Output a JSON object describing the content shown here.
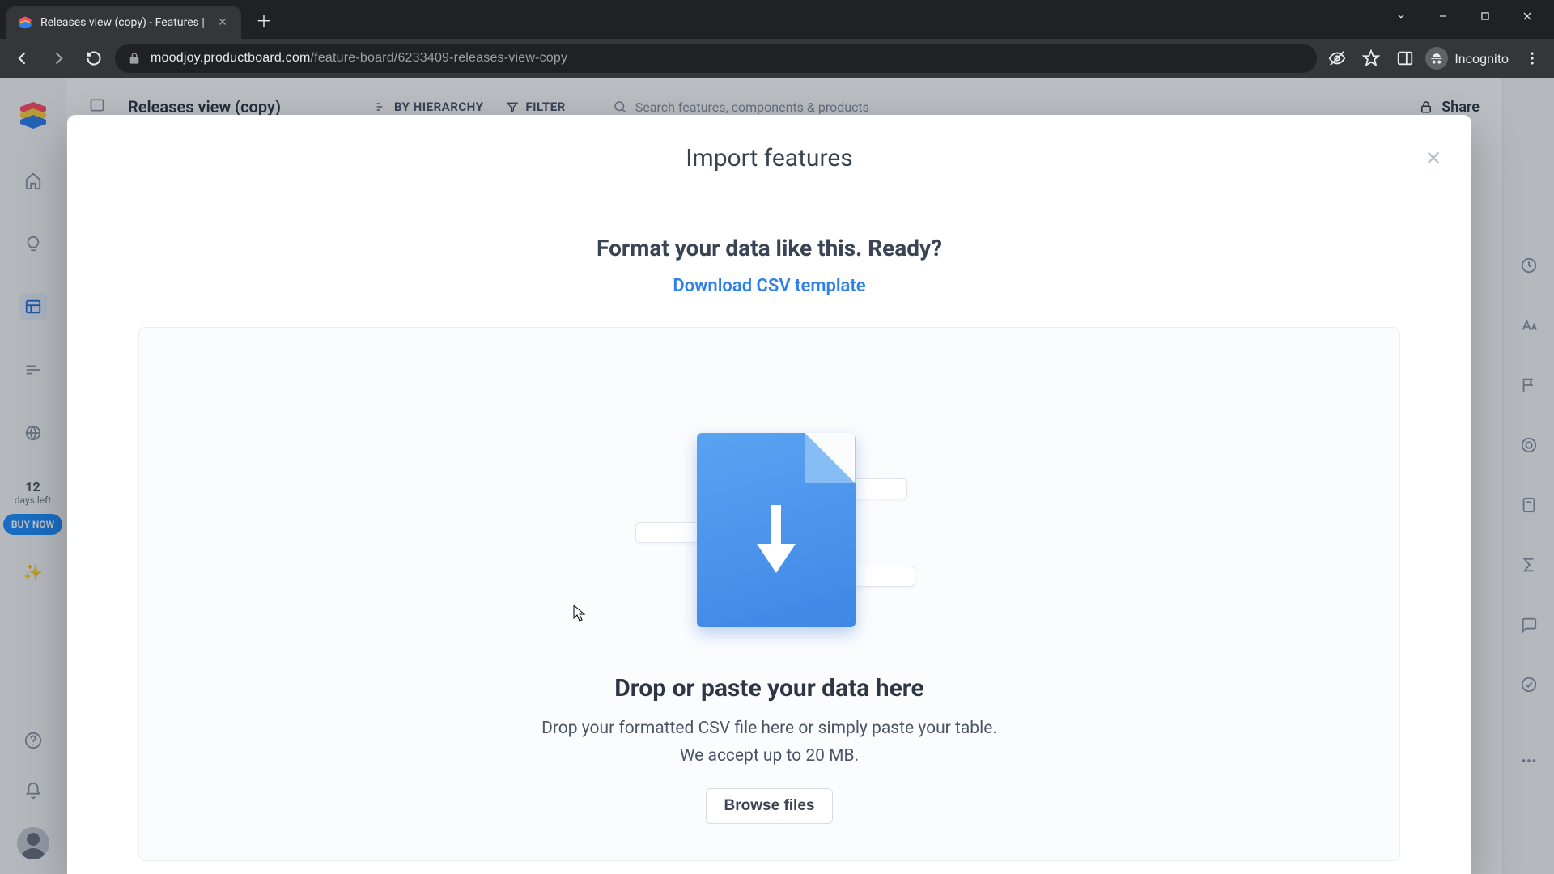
{
  "browser": {
    "tab_title": "Releases view (copy) - Features |",
    "url_host": "moodjoy.productboard.com",
    "url_path": "/feature-board/6233409-releases-view-copy",
    "incognito_label": "Incognito"
  },
  "rail": {
    "trial_number": "12",
    "trial_sub": "days left",
    "buy_label": "BUY NOW"
  },
  "header": {
    "title": "Releases view (copy)",
    "hierarchy_label": "BY HIERARCHY",
    "filter_label": "FILTER",
    "search_placeholder": "Search features, components & products",
    "share_label": "Share"
  },
  "modal": {
    "title": "Import features",
    "format_line": "Format your data like this. Ready?",
    "download_link": "Download CSV template",
    "dz_heading": "Drop or paste your data here",
    "dz_sub1": "Drop your formatted CSV file here or simply paste your table.",
    "dz_sub2": "We accept up to 20 MB.",
    "browse_label": "Browse files"
  }
}
